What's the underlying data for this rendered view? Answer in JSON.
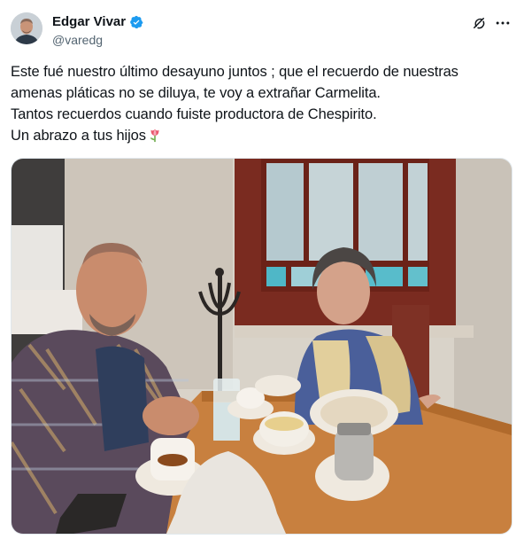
{
  "author": {
    "display_name": "Edgar Vivar",
    "handle": "@varedg",
    "verified": true
  },
  "tweet": {
    "lines": [
      "Este fué nuestro último desayuno juntos ; que el recuerdo de nuestras",
      "amenas pláticas no se diluya, te voy a extrañar Carmelita.",
      "Tantos recuerdos cuando fuiste productora de Chespirito.",
      "Un abrazo a tus hijos"
    ],
    "emoji": "tulip-icon"
  },
  "icons": {
    "verified": "verified-badge-icon",
    "grok": "grok-icon",
    "more": "more-options-icon"
  },
  "colors": {
    "verified_blue": "#1d9bf0",
    "text_primary": "#0f1419",
    "text_secondary": "#536471"
  }
}
